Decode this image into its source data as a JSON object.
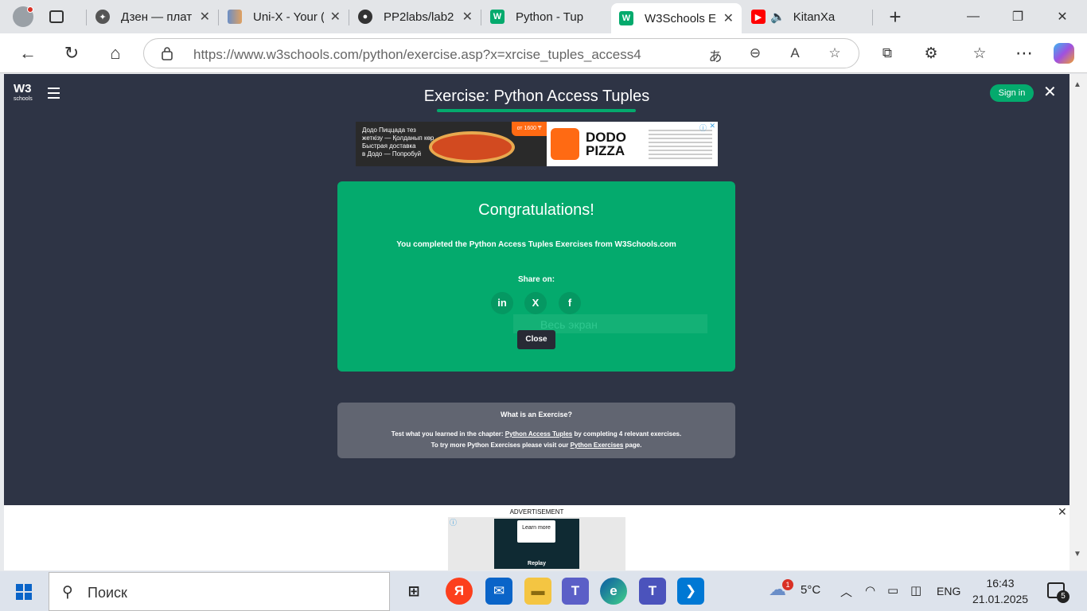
{
  "browser": {
    "tabs": [
      {
        "title": "Дзен — плат",
        "favicon": "dzen-icon"
      },
      {
        "title": "Uni-X - Your (",
        "favicon": "unix-icon"
      },
      {
        "title": "PP2labs/lab2",
        "favicon": "github-icon"
      },
      {
        "title": "Python - Tup",
        "favicon": "w3schools-icon"
      },
      {
        "title": "W3Schools E",
        "favicon": "w3schools-icon",
        "active": true
      },
      {
        "title": "KitanXa",
        "favicon": "youtube-icon"
      }
    ],
    "new_tab": "+",
    "url_domain": "https://www.w3schools.com",
    "url_path": "/python/exercise.asp?x=xrcise_tuples_access4"
  },
  "header": {
    "logo_main": "W3",
    "logo_sub": "schools",
    "title": "Exercise: Python Access Tuples",
    "signin_label": "Sign in",
    "close_label": "✕"
  },
  "top_ad": {
    "text_line1": "Додо Пиццада тез",
    "text_line2": "жеткізу — Қолданып көр",
    "text_line3": "Быстрая доставка",
    "text_line4": "в Додо — Попробуй",
    "badge": "от 1600 ₸",
    "brand_line1": "DODO",
    "brand_line2": "PIZZA"
  },
  "congrats": {
    "heading": "Congratulations!",
    "subtitle": "You completed the Python Access Tuples Exercises from W3Schools.com",
    "share_label": "Share on:",
    "social": [
      "in",
      "X",
      "f"
    ],
    "overlay_hint": "Весь экран",
    "close_label": "Close"
  },
  "whatis": {
    "heading": "What is an Exercise?",
    "line1_prefix": "Test what you learned in the chapter: ",
    "line1_link": "Python Access Tuples",
    "line1_suffix": " by completing 4 relevant exercises.",
    "line2_prefix": "To try more Python Exercises please visit our ",
    "line2_link": "Python Exercises",
    "line2_suffix": " page."
  },
  "bottom_ad": {
    "label": "ADVERTISEMENT",
    "learn_more": "Learn more",
    "replay": "Replay"
  },
  "taskbar": {
    "search_placeholder": "Поиск",
    "weather_badge": "1",
    "temperature": "5°C",
    "language": "ENG",
    "time": "16:43",
    "date": "21.01.2025",
    "notifications": "5"
  }
}
